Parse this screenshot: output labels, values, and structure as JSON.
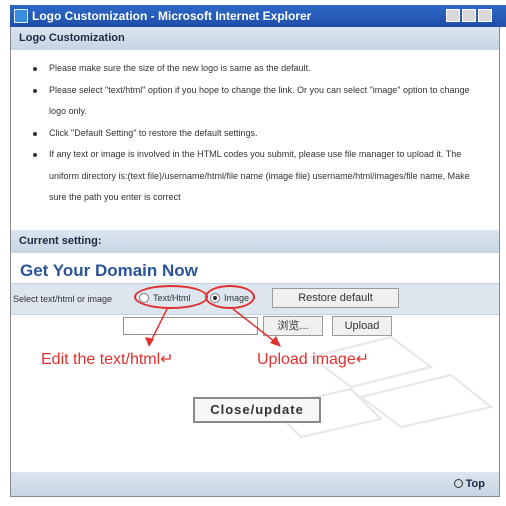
{
  "window": {
    "title": "Logo Customization - Microsoft Internet Explorer"
  },
  "header": {
    "title": "Logo Customization"
  },
  "notes": [
    "Please make sure the size of the new logo is same as the default.",
    "Please select \"text/html\" option if you hope to change the link. Or you can select \"image\" option to change logo only.",
    "Click \"Default Setting\" to restore the default settings.",
    "If any text or image is involved in the HTML codes you submit, please use file manager to upload it. The uniform directory is:(text file)/username/html/file name (image file) username/html/images/file name, Make sure the path you enter is correct"
  ],
  "current_setting": {
    "label": "Current setting:",
    "heading": "Get Your Domain Now"
  },
  "select": {
    "label": "Select text/html or image",
    "options": [
      {
        "label": "Text/Html",
        "checked": false
      },
      {
        "label": "Image",
        "checked": true
      }
    ],
    "restore_button": "Restore default"
  },
  "upload": {
    "browse_button": "浏览...",
    "upload_button": "Upload"
  },
  "annotations": {
    "edit_text": "Edit the text/html↵",
    "upload_image": "Upload image↵",
    "color": "#e0312f"
  },
  "close_button": "Close/update",
  "footer": {
    "top_link": "Top"
  }
}
